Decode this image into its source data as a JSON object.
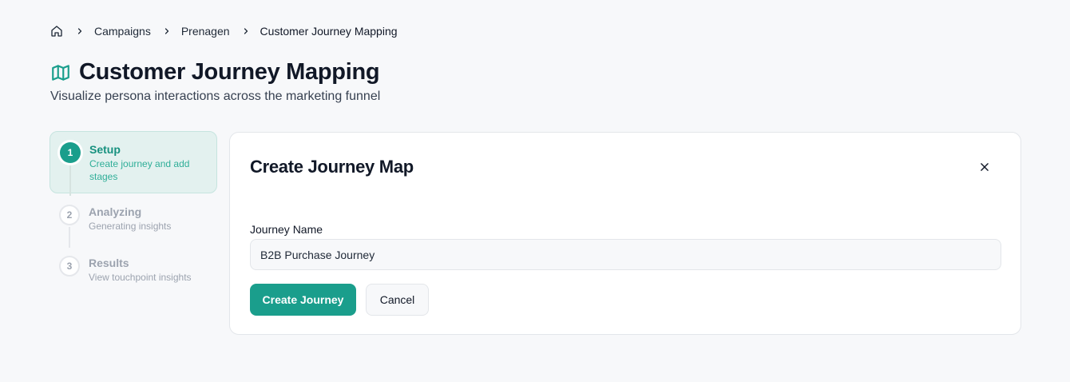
{
  "breadcrumb": {
    "home_icon": "home-icon",
    "items": [
      "Campaigns",
      "Prenagen",
      "Customer Journey Mapping"
    ]
  },
  "header": {
    "icon": "map-icon",
    "title": "Customer Journey Mapping",
    "subtitle": "Visualize persona interactions across the marketing funnel"
  },
  "steps": [
    {
      "number": "1",
      "title": "Setup",
      "description": "Create journey and add stages",
      "state": "active"
    },
    {
      "number": "2",
      "title": "Analyzing",
      "description": "Generating insights",
      "state": "pending"
    },
    {
      "number": "3",
      "title": "Results",
      "description": "View touchpoint insights",
      "state": "pending"
    }
  ],
  "dialog": {
    "title": "Create Journey Map",
    "close_icon": "close-icon",
    "field_label": "Journey Name",
    "field_value": "B2B Purchase Journey",
    "primary_label": "Create Journey",
    "secondary_label": "Cancel"
  },
  "colors": {
    "accent": "#1a9e8c",
    "accent_light": "#e3f1ef",
    "background": "#f7f8fa",
    "muted_text": "#9ca3af"
  }
}
